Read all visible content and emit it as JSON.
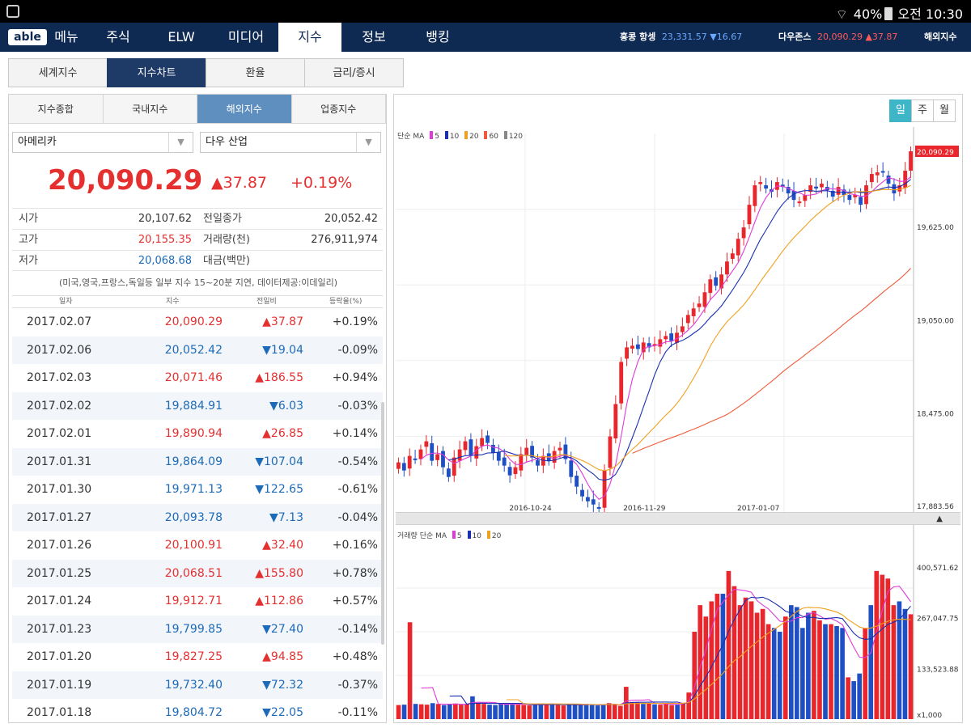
{
  "status_bar": {
    "battery": "40%",
    "time": "오전 10:30"
  },
  "nav": {
    "logo": "able",
    "items": [
      "메뉴",
      "주식",
      "ELW",
      "미디어",
      "지수",
      "정보",
      "뱅킹"
    ],
    "active": "지수",
    "tickers": [
      {
        "label": "홍콩 항셍",
        "value": "23,331.57",
        "change": "▼16.67",
        "dir": "down"
      },
      {
        "label": "다우존스",
        "value": "20,090.29",
        "change": "▲37.87",
        "dir": "up"
      }
    ],
    "overseas_button": "해외지수"
  },
  "subtabs": {
    "items": [
      "세계지수",
      "지수차트",
      "환율",
      "금리/증시"
    ],
    "active": "지수차트"
  },
  "left": {
    "tabs": [
      "지수종합",
      "국내지수",
      "해외지수",
      "업종지수"
    ],
    "active_tab": "해외지수",
    "region_select": "아메리카",
    "index_select": "다우 산업",
    "price": "20,090.29",
    "change": "▲37.87",
    "change_pct": "+0.19%",
    "info": {
      "open_label": "시가",
      "open": "20,107.62",
      "prev_close_label": "전일종가",
      "prev_close": "20,052.42",
      "high_label": "고가",
      "high": "20,155.35",
      "volume_label": "거래량(천)",
      "volume": "276,911,974",
      "low_label": "저가",
      "low": "20,068.68",
      "amount_label": "대금(백만)",
      "amount": ""
    },
    "note": "(미국,영국,프랑스,독일등 일부 지수 15~20분 지연, 데이터제공:이데일리)",
    "history_headers": [
      "일자",
      "지수",
      "전일비",
      "등락율(%)"
    ],
    "history": [
      {
        "date": "2017.02.07",
        "value": "20,090.29",
        "change": "▲37.87",
        "pct": "+0.19%",
        "dir": "up"
      },
      {
        "date": "2017.02.06",
        "value": "20,052.42",
        "change": "▼19.04",
        "pct": "-0.09%",
        "dir": "down"
      },
      {
        "date": "2017.02.03",
        "value": "20,071.46",
        "change": "▲186.55",
        "pct": "+0.94%",
        "dir": "up"
      },
      {
        "date": "2017.02.02",
        "value": "19,884.91",
        "change": "▼6.03",
        "pct": "-0.03%",
        "dir": "down"
      },
      {
        "date": "2017.02.01",
        "value": "19,890.94",
        "change": "▲26.85",
        "pct": "+0.14%",
        "dir": "up"
      },
      {
        "date": "2017.01.31",
        "value": "19,864.09",
        "change": "▼107.04",
        "pct": "-0.54%",
        "dir": "down"
      },
      {
        "date": "2017.01.30",
        "value": "19,971.13",
        "change": "▼122.65",
        "pct": "-0.61%",
        "dir": "down"
      },
      {
        "date": "2017.01.27",
        "value": "20,093.78",
        "change": "▼7.13",
        "pct": "-0.04%",
        "dir": "down"
      },
      {
        "date": "2017.01.26",
        "value": "20,100.91",
        "change": "▲32.40",
        "pct": "+0.16%",
        "dir": "up"
      },
      {
        "date": "2017.01.25",
        "value": "20,068.51",
        "change": "▲155.80",
        "pct": "+0.78%",
        "dir": "up"
      },
      {
        "date": "2017.01.24",
        "value": "19,912.71",
        "change": "▲112.86",
        "pct": "+0.57%",
        "dir": "up"
      },
      {
        "date": "2017.01.23",
        "value": "19,799.85",
        "change": "▼27.40",
        "pct": "-0.14%",
        "dir": "down"
      },
      {
        "date": "2017.01.20",
        "value": "19,827.25",
        "change": "▲94.85",
        "pct": "+0.48%",
        "dir": "up"
      },
      {
        "date": "2017.01.19",
        "value": "19,732.40",
        "change": "▼72.32",
        "pct": "-0.37%",
        "dir": "down"
      },
      {
        "date": "2017.01.18",
        "value": "19,804.72",
        "change": "▼22.05",
        "pct": "-0.11%",
        "dir": "down"
      }
    ]
  },
  "chart": {
    "periods": [
      "일",
      "주",
      "월"
    ],
    "active_period": "일",
    "price_legend": {
      "label": "단순 MA",
      "items": [
        "5",
        "10",
        "20",
        "60",
        "120"
      ]
    },
    "volume_legend": {
      "label": "거래량 단순 MA",
      "items": [
        "5",
        "10",
        "20"
      ]
    },
    "price_labels": [
      "20,090.29",
      "19,625.00",
      "19,050.00",
      "18,475.00",
      "17,883.56"
    ],
    "x_labels": [
      "2016-10-24",
      "2016-11-29",
      "2017-01-07"
    ],
    "volume_labels": [
      "400,571.62",
      "267,047.75",
      "133,523.88",
      "x1,000"
    ],
    "colors": {
      "up": "#e8262b",
      "down": "#1f4fc4",
      "ma5": "#e03ad8",
      "ma10": "#1b2fb0",
      "ma20": "#f0a020",
      "ma60": "#f05a3a",
      "ma120": "#888888"
    }
  },
  "chart_data": {
    "type": "candlestick",
    "ylim": [
      17883.56,
      20200
    ],
    "x_ticks": [
      "2016-10-24",
      "2016-11-29",
      "2017-01-07"
    ],
    "close_series": [
      18170,
      18120,
      18210,
      18190,
      18250,
      18300,
      18180,
      18220,
      18140,
      18080,
      18200,
      18250,
      18300,
      18210,
      18270,
      18320,
      18290,
      18230,
      18180,
      18150,
      18090,
      18140,
      18220,
      18260,
      18200,
      18150,
      18210,
      18180,
      18240,
      18260,
      18190,
      18080,
      18020,
      17960,
      17930,
      17910,
      17890,
      18120,
      18330,
      18530,
      18790,
      18880,
      18890,
      18870,
      18910,
      18880,
      18900,
      18930,
      18950,
      18920,
      18970,
      19010,
      19080,
      19120,
      19150,
      19220,
      19300,
      19260,
      19330,
      19410,
      19460,
      19550,
      19620,
      19760,
      19880,
      19900,
      19860,
      19840,
      19900,
      19870,
      19830,
      19790,
      19780,
      19820,
      19880,
      19860,
      19890,
      19850,
      19810,
      19870,
      19820,
      19790,
      19820,
      19760,
      19880,
      19950,
      19960,
      19960,
      19890,
      19830,
      19880,
      19970,
      20090
    ],
    "volume_series": [
      37,
      38,
      255,
      40,
      39,
      38,
      42,
      40,
      37,
      39,
      41,
      38,
      40,
      60,
      42,
      40,
      38,
      37,
      41,
      39,
      40,
      38,
      37,
      36,
      39,
      40,
      38,
      41,
      37,
      36,
      39,
      38,
      37,
      40,
      38,
      36,
      37,
      42,
      40,
      35,
      85,
      45,
      44,
      40,
      42,
      39,
      38,
      41,
      37,
      38,
      43,
      70,
      230,
      300,
      270,
      310,
      330,
      330,
      390,
      350,
      300,
      320,
      310,
      280,
      290,
      250,
      240,
      230,
      270,
      300,
      295,
      240,
      280,
      285,
      260,
      250,
      250,
      245,
      240,
      110,
      100,
      120,
      240,
      300,
      390,
      380,
      370,
      300,
      310,
      290,
      276
    ],
    "volume_ylim": [
      0,
      460
    ]
  }
}
